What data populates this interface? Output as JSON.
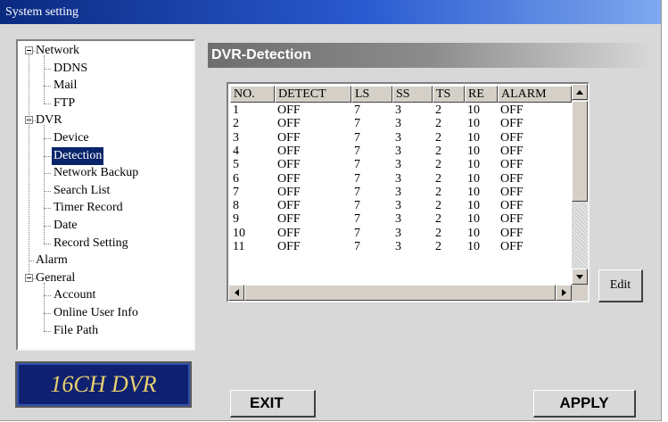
{
  "window": {
    "title": "System setting"
  },
  "tree": [
    {
      "label": "Network",
      "level": 0,
      "expanded": true
    },
    {
      "label": "DDNS",
      "level": 1
    },
    {
      "label": "Mail",
      "level": 1
    },
    {
      "label": "FTP",
      "level": 1
    },
    {
      "label": "DVR",
      "level": 0,
      "expanded": true
    },
    {
      "label": "Device",
      "level": 1
    },
    {
      "label": "Detection",
      "level": 1,
      "selected": true
    },
    {
      "label": "Network Backup",
      "level": 1
    },
    {
      "label": "Search List",
      "level": 1
    },
    {
      "label": "Timer Record",
      "level": 1
    },
    {
      "label": "Date",
      "level": 1
    },
    {
      "label": "Record Setting",
      "level": 1
    },
    {
      "label": "Alarm",
      "level": 0,
      "leaf": true
    },
    {
      "label": "General",
      "level": 0,
      "expanded": true
    },
    {
      "label": "Account",
      "level": 1
    },
    {
      "label": "Online User Info",
      "level": 1
    },
    {
      "label": "File Path",
      "level": 1
    }
  ],
  "brand": {
    "text": "16CH DVR"
  },
  "panel": {
    "title": "DVR-Detection"
  },
  "table": {
    "columns": [
      "NO.",
      "DETECT",
      "LS",
      "SS",
      "TS",
      "RE",
      "ALARM"
    ],
    "rows": [
      [
        "1",
        "OFF",
        "7",
        "3",
        "2",
        "10",
        "OFF"
      ],
      [
        "2",
        "OFF",
        "7",
        "3",
        "2",
        "10",
        "OFF"
      ],
      [
        "3",
        "OFF",
        "7",
        "3",
        "2",
        "10",
        "OFF"
      ],
      [
        "4",
        "OFF",
        "7",
        "3",
        "2",
        "10",
        "OFF"
      ],
      [
        "5",
        "OFF",
        "7",
        "3",
        "2",
        "10",
        "OFF"
      ],
      [
        "6",
        "OFF",
        "7",
        "3",
        "2",
        "10",
        "OFF"
      ],
      [
        "7",
        "OFF",
        "7",
        "3",
        "2",
        "10",
        "OFF"
      ],
      [
        "8",
        "OFF",
        "7",
        "3",
        "2",
        "10",
        "OFF"
      ],
      [
        "9",
        "OFF",
        "7",
        "3",
        "2",
        "10",
        "OFF"
      ],
      [
        "10",
        "OFF",
        "7",
        "3",
        "2",
        "10",
        "OFF"
      ],
      [
        "11",
        "OFF",
        "7",
        "3",
        "2",
        "10",
        "OFF"
      ]
    ]
  },
  "buttons": {
    "edit": "Edit",
    "exit": "EXIT",
    "apply": "APPLY"
  },
  "colors": {
    "titlebar": "#0a2a80",
    "selection": "#0a246a",
    "brand_bg": "#102070",
    "brand_text": "#e8d070"
  }
}
